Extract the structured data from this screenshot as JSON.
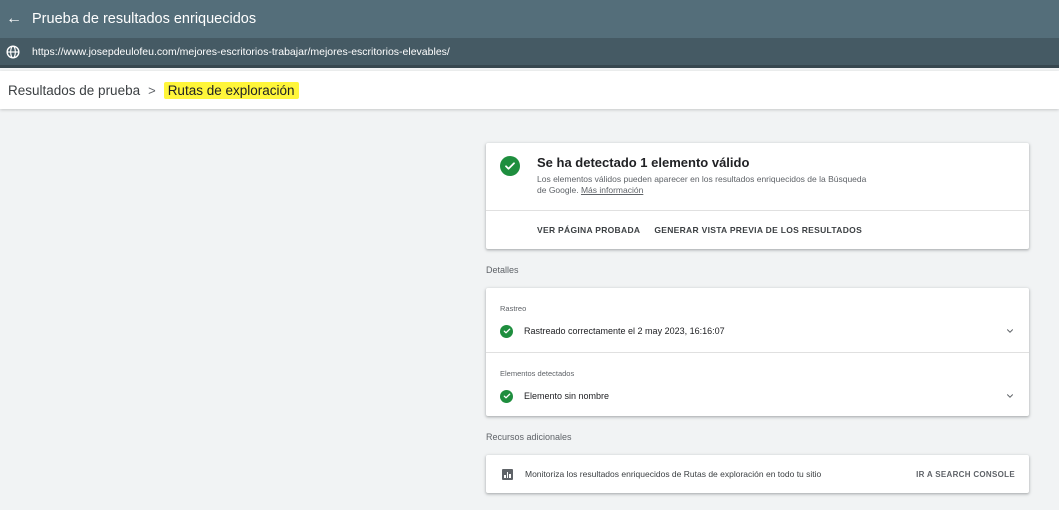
{
  "header": {
    "back_icon": "arrow-left-icon",
    "title": "Prueba de resultados enriquecidos"
  },
  "urlbar": {
    "icon": "globe-icon",
    "url": "https://www.josepdeulofeu.com/mejores-escritorios-trabajar/mejores-escritorios-elevables/"
  },
  "breadcrumb": {
    "parent": "Resultados de prueba",
    "separator": ">",
    "current": "Rutas de exploración",
    "highlight_color": "#fff63a"
  },
  "summary": {
    "icon": "check-circle-icon",
    "heading": "Se ha detectado 1 elemento válido",
    "description": "Los elementos válidos pueden aparecer en los resultados enriquecidos de la Búsqueda de Google.",
    "link": "Más información",
    "actions": [
      "VER PÁGINA PROBADA",
      "GENERAR VISTA PREVIA DE LOS RESULTADOS"
    ]
  },
  "details": {
    "label": "Detalles",
    "groups": [
      {
        "label": "Rastreo",
        "item": "Rastreado correctamente el 2 may 2023, 16:16:07"
      },
      {
        "label": "Elementos detectados",
        "item": "Elemento sin nombre"
      }
    ]
  },
  "resources": {
    "label": "Recursos adicionales",
    "icon": "bar-chart-icon",
    "text": "Monitoriza los resultados enriquecidos de Rutas de exploración en todo tu sitio",
    "link": "IR A SEARCH CONSOLE"
  },
  "colors": {
    "header_bg": "#546e7a",
    "urlbar_bg": "#455a64",
    "success_green": "#1e8e3e",
    "page_bg": "#f1f3f4"
  }
}
